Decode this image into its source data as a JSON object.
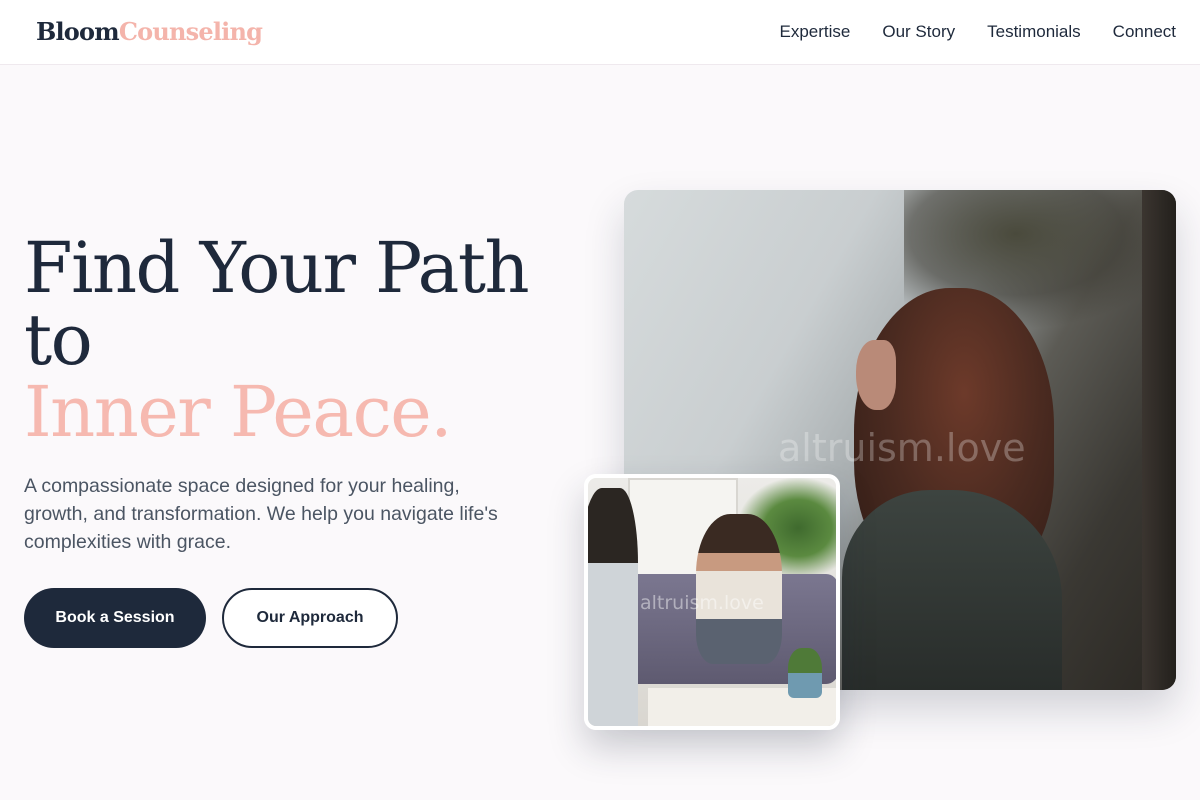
{
  "brand": {
    "part1": "Bloom",
    "part2": "Counseling"
  },
  "nav": [
    "Expertise",
    "Our Story",
    "Testimonials",
    "Connect"
  ],
  "hero": {
    "title_line1": "Find Your Path",
    "title_line2": "to",
    "title_accent": "Inner Peace.",
    "subtitle": "A compassionate space designed for your healing, growth, and transformation. We help you navigate life's complexities with grace.",
    "primary_button": "Book a Session",
    "secondary_button": "Our Approach"
  },
  "images": {
    "main_watermark": "altruism.love",
    "inset_watermark": "altruism.love"
  },
  "colors": {
    "navy": "#1e293b",
    "blush": "#f6b9b0",
    "background": "#fbf9fb"
  }
}
